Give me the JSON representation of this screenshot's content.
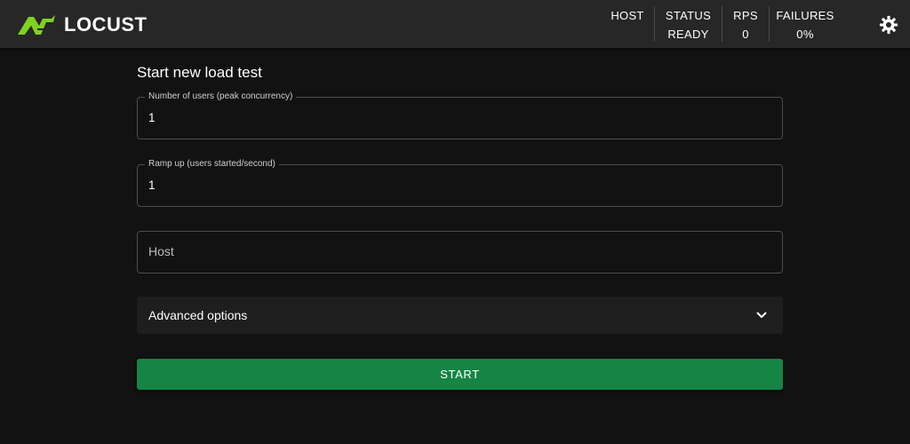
{
  "app": {
    "name": "LOCUST",
    "logo_color": "#7ed321"
  },
  "header": {
    "stats": [
      {
        "label": "HOST",
        "value": ""
      },
      {
        "label": "STATUS",
        "value": "READY"
      },
      {
        "label": "RPS",
        "value": "0"
      },
      {
        "label": "FAILURES",
        "value": "0%"
      }
    ],
    "settings_icon": "gear-icon"
  },
  "form": {
    "title": "Start new load test",
    "users": {
      "label": "Number of users (peak concurrency)",
      "value": "1"
    },
    "ramp_up": {
      "label": "Ramp up (users started/second)",
      "value": "1"
    },
    "host": {
      "placeholder": "Host",
      "value": ""
    },
    "advanced": {
      "label": "Advanced options",
      "icon": "chevron-down-icon"
    },
    "start_label": "START"
  },
  "colors": {
    "background": "#121212",
    "appbar": "#272727",
    "start_button": "#158444",
    "accent_green": "#7ed321"
  }
}
